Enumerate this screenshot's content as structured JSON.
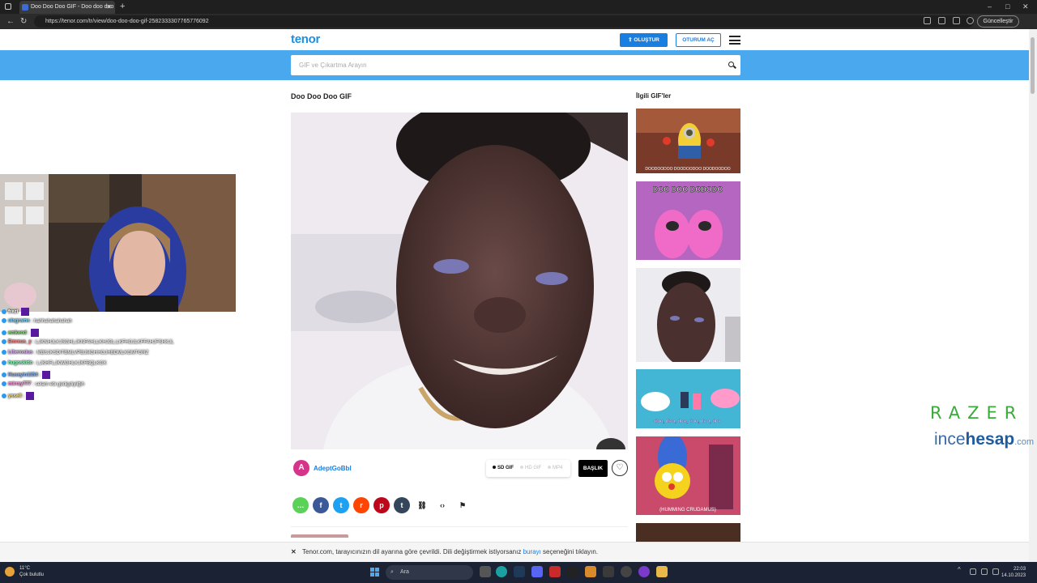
{
  "browser": {
    "tab_title": "Doo Doo Doo GIF - Doo doo doo",
    "new_tab": "+",
    "url": "https://tenor.com/tr/view/doo-doo-doo-gif-25823333077657760​92",
    "update_label": "Güncelleştir",
    "minimize": "–",
    "maximize": "□",
    "close": "✕"
  },
  "header": {
    "logo": "tenor",
    "create_label": "OLUŞTUR",
    "login_label": "OTURUM AÇ"
  },
  "search": {
    "placeholder": "GIF ve Çıkartma Arayın"
  },
  "gif": {
    "title": "Doo Doo Doo GIF",
    "user_initial": "A",
    "user_name": "AdeptGoBbl",
    "formats": [
      "SD GIF",
      "HD GIF",
      "MP4"
    ],
    "caption_label": "BAŞLIK",
    "favorite_icon": "heart-icon"
  },
  "share": {
    "items": [
      {
        "name": "imessage",
        "icon": "…",
        "color": "#5ad157"
      },
      {
        "name": "facebook",
        "icon": "f",
        "color": "#3b5998"
      },
      {
        "name": "twitter",
        "icon": "t",
        "color": "#1da1f2"
      },
      {
        "name": "reddit",
        "icon": "r",
        "color": "#ff4500"
      },
      {
        "name": "pinterest",
        "icon": "p",
        "color": "#bd081c"
      },
      {
        "name": "tumblr",
        "icon": "t",
        "color": "#35465c"
      },
      {
        "name": "link",
        "icon": "⛓",
        "color": ""
      },
      {
        "name": "embed",
        "icon": "‹›",
        "color": ""
      },
      {
        "name": "report",
        "icon": "⚑",
        "color": ""
      }
    ]
  },
  "related": {
    "title": "İlgili GIF'ler",
    "items": [
      {
        "caption": "DOODOODOO DOODOODOO DOODOODOO"
      },
      {
        "caption": "DOO DOO DODODO"
      },
      {
        "caption": ""
      },
      {
        "caption": "doo, doo, doo, doo, doo, doo"
      },
      {
        "caption": "(HUMMING CRUDAMUS)"
      },
      {
        "caption": ""
      }
    ]
  },
  "notice": {
    "close": "✕",
    "text_before": "Tenor.com, tarayıcınızın dil ayarına göre çevrildi. Dili değiştirmek istiyorsanız",
    "link": "burayı",
    "text_after": "seçeneğini tıklayın."
  },
  "taskbar": {
    "weather_temp": "11°C",
    "weather_desc": "Çok bulutlu",
    "search_label": "Ara",
    "time": "22:03",
    "date": "14.10.2023"
  },
  "chat": [
    {
      "user": "frezi",
      "msg": "",
      "color": "#ffffff",
      "sq": true
    },
    {
      "user": "ulagrams",
      "msg": ": hahhahahahahah",
      "color": "#7fd7ff",
      "sq": false
    },
    {
      "user": "emkend",
      "msg": ":",
      "color": "#7fe06e",
      "sq": true
    },
    {
      "user": "Emreus_y",
      "msg": ": LJKNHJLKJSGHLJKNFAHLLKHJGL;LKFHGJLKFFAHJFSHKJL",
      "color": "#ff8a8a",
      "sq": false
    },
    {
      "user": "Liberosius",
      "msg": ": MBSJKSDITBMLVPBJMGHHGJHBDMLKGMTGRZ",
      "color": "#e6b0ff",
      "sq": false
    },
    {
      "user": "hugoskido",
      "msg": ": LJKHFLJKWGHLKJKFBQLKGK",
      "color": "#8affc0",
      "sq": false
    },
    {
      "user": "Huseyin1354",
      "msg": ":",
      "color": "#80b4ff",
      "sq": true
    },
    {
      "user": "mirray777",
      "msg": ": selam ebi güdigdiyilğih",
      "color": "#ff9ae0",
      "sq": false
    },
    {
      "user": "yssell",
      "msg": ":",
      "color": "#ffe680",
      "sq": true
    }
  ],
  "overlay": {
    "razer": "RAZER",
    "ince": "ince",
    "hesap": "hesap",
    "dotcom": ".com"
  }
}
